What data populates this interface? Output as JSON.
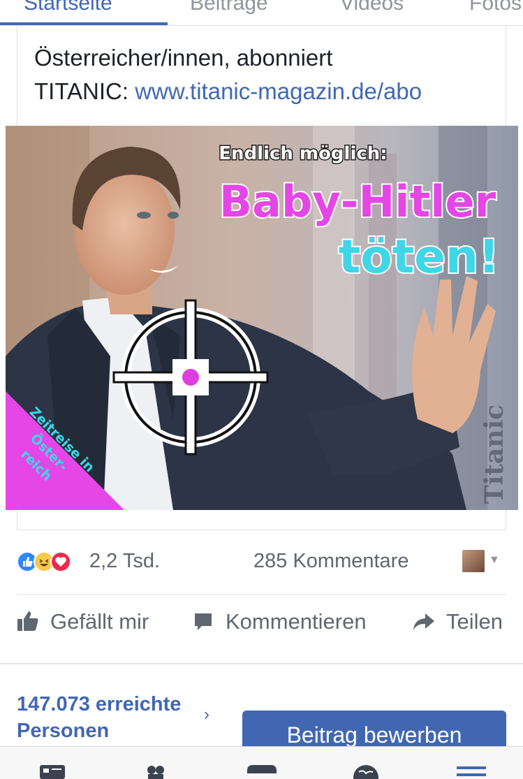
{
  "tabs": [
    {
      "label": "Startseite",
      "active": true
    },
    {
      "label": "Beiträge",
      "active": false
    },
    {
      "label": "Videos",
      "active": false
    },
    {
      "label": "Fotos",
      "active": false
    }
  ],
  "post": {
    "text_line1": "Österreicher/innen, abonniert",
    "text_prefix": "TITANIC: ",
    "link": "www.titanic-magazin.de/abo",
    "image": {
      "headline_small": "Endlich möglich:",
      "headline_pink": "Baby-Hitler",
      "headline_cyan": "töten!",
      "corner_banner": [
        "Zeitreise in",
        "Öster-",
        "reich"
      ],
      "watermark": "Titanic",
      "colors": {
        "pink": "#e546e6",
        "cyan": "#3fd6e8",
        "crosshair_dot": "#e03de0"
      }
    }
  },
  "stats": {
    "reactions_count": "2,2 Tsd.",
    "comments": "285 Kommentare",
    "reaction_icons": [
      "like-icon",
      "haha-icon",
      "love-icon"
    ]
  },
  "actions": {
    "like": "Gefällt mir",
    "comment": "Kommentieren",
    "share": "Teilen"
  },
  "reach": {
    "line1": "147.073 erreichte",
    "line2": "Personen",
    "promote_button": "Beitrag bewerben"
  },
  "bottom_nav": [
    "news-feed-icon",
    "friends-icon",
    "marketplace-icon",
    "globe-icon",
    "menu-icon"
  ],
  "colors": {
    "accent": "#4267b2",
    "text": "#1d2129",
    "muted": "#606770"
  }
}
